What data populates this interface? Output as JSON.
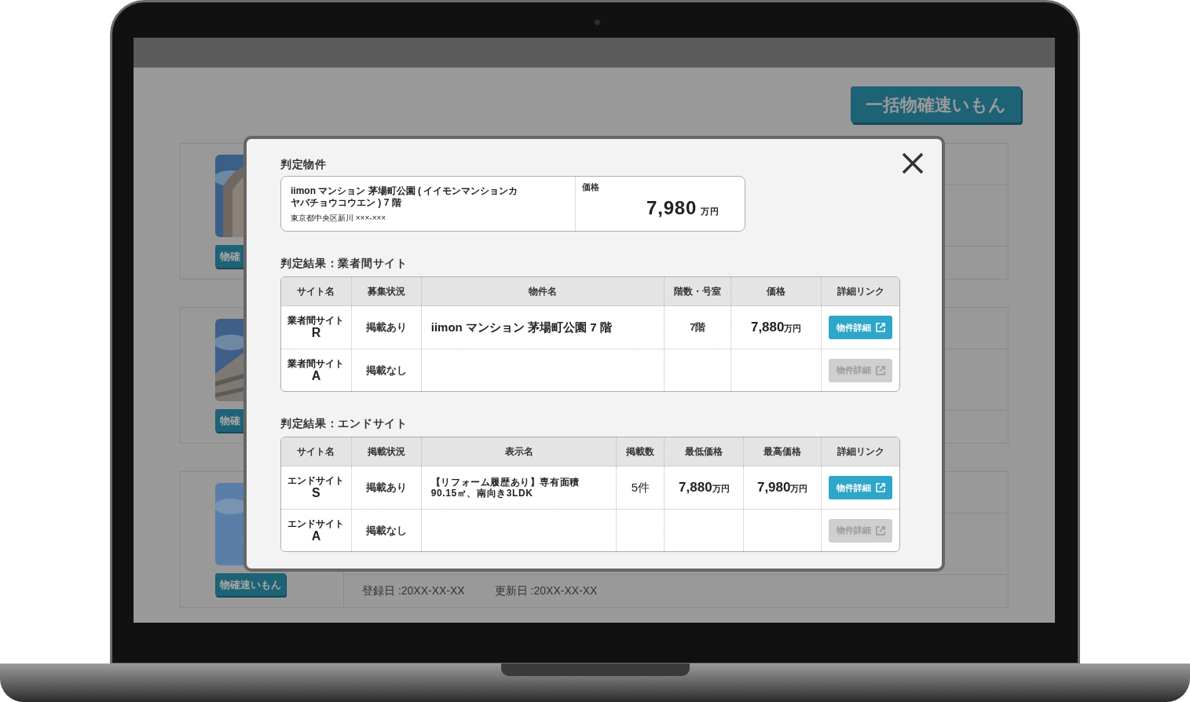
{
  "top_button": "一括物確速いもん",
  "cards": [
    {
      "button": "物確"
    },
    {
      "button": "物確"
    },
    {
      "button": "物確速いもん",
      "registered": "登録日 :20XX-XX-XX",
      "updated": "更新日 :20XX-XX-XX"
    }
  ],
  "modal": {
    "title": "判定物件",
    "property": {
      "name": "iimon マンション 茅場町公園 ( イイモンマンションカヤバチョウコウエン ) 7 階",
      "address": "東京都中央区新川 ×××-×××",
      "price_label": "価格",
      "price": "7,980",
      "price_unit": "万円"
    },
    "sections": [
      {
        "title": "判定結果：業者間サイト",
        "columns": [
          "サイト名",
          "募集状況",
          "物件名",
          "階数・号室",
          "価格",
          "詳細リンク"
        ],
        "rows": [
          {
            "cells": [
              {
                "kind": "site",
                "site_type": "業者間サイト",
                "site": "R"
              },
              {
                "kind": "text",
                "text": "掲載あり"
              },
              {
                "kind": "name",
                "text": "iimon マンション 茅場町公園 7 階"
              },
              {
                "kind": "text",
                "text": "7階"
              },
              {
                "kind": "price",
                "value": "7,880",
                "unit": "万円"
              },
              {
                "kind": "link",
                "label": "物件詳細",
                "disabled": false
              }
            ]
          },
          {
            "cells": [
              {
                "kind": "site",
                "site_type": "業者間サイト",
                "site": "A"
              },
              {
                "kind": "text",
                "text": "掲載なし"
              },
              "",
              "",
              "",
              {
                "kind": "link",
                "label": "物件詳細",
                "disabled": true
              }
            ]
          }
        ]
      },
      {
        "title": "判定結果：エンドサイト",
        "columns": [
          "サイト名",
          "掲載状況",
          "表示名",
          "掲載数",
          "最低価格",
          "最高価格",
          "詳細リンク"
        ],
        "rows": [
          {
            "cells": [
              {
                "kind": "site",
                "site_type": "エンドサイト",
                "site": "S"
              },
              {
                "kind": "text",
                "text": "掲載あり"
              },
              {
                "kind": "title",
                "text": "【リフォーム履歴あり】専有面積 90.15㎡、南向き3LDK"
              },
              {
                "kind": "count",
                "text": "5件"
              },
              {
                "kind": "price",
                "value": "7,880",
                "unit": "万円"
              },
              {
                "kind": "price",
                "value": "7,980",
                "unit": "万円"
              },
              {
                "kind": "link",
                "label": "物件詳細",
                "disabled": false
              }
            ]
          },
          {
            "cells": [
              {
                "kind": "site",
                "site_type": "エンドサイト",
                "site": "A"
              },
              {
                "kind": "text",
                "text": "掲載なし"
              },
              "",
              "",
              "",
              "",
              {
                "kind": "link",
                "label": "物件詳細",
                "disabled": true
              }
            ]
          }
        ]
      }
    ]
  }
}
